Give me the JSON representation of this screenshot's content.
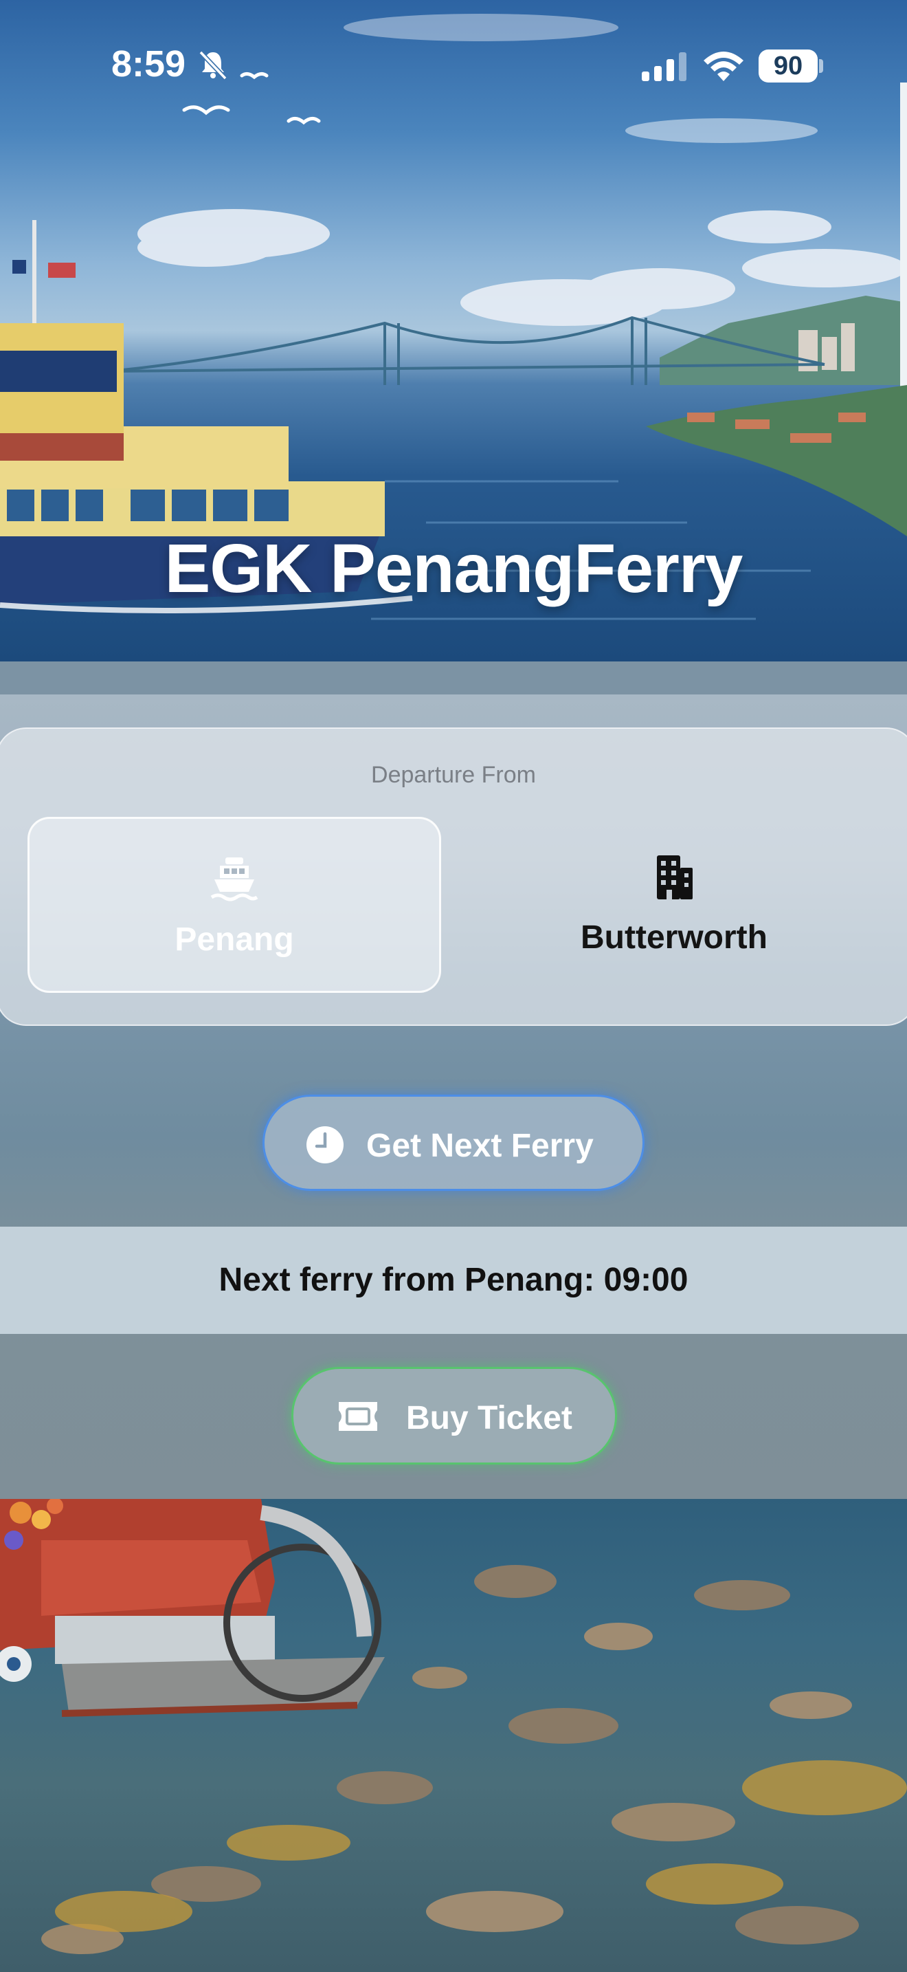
{
  "status_bar": {
    "time": "8:59",
    "battery": "90"
  },
  "app": {
    "title": "EGK PenangFerry"
  },
  "departure": {
    "label": "Departure From",
    "options": [
      {
        "label": "Penang",
        "icon": "ferry-icon",
        "selected": true
      },
      {
        "label": "Butterworth",
        "icon": "building-icon",
        "selected": false
      }
    ]
  },
  "actions": {
    "next_ferry_label": "Get Next Ferry",
    "buy_ticket_label": "Buy Ticket"
  },
  "result": {
    "text": "Next ferry from Penang: 09:00"
  },
  "colors": {
    "next_ferry_border": "#4d8ee6",
    "buy_ticket_border": "#58c46e",
    "title_text": "#ffffff"
  }
}
